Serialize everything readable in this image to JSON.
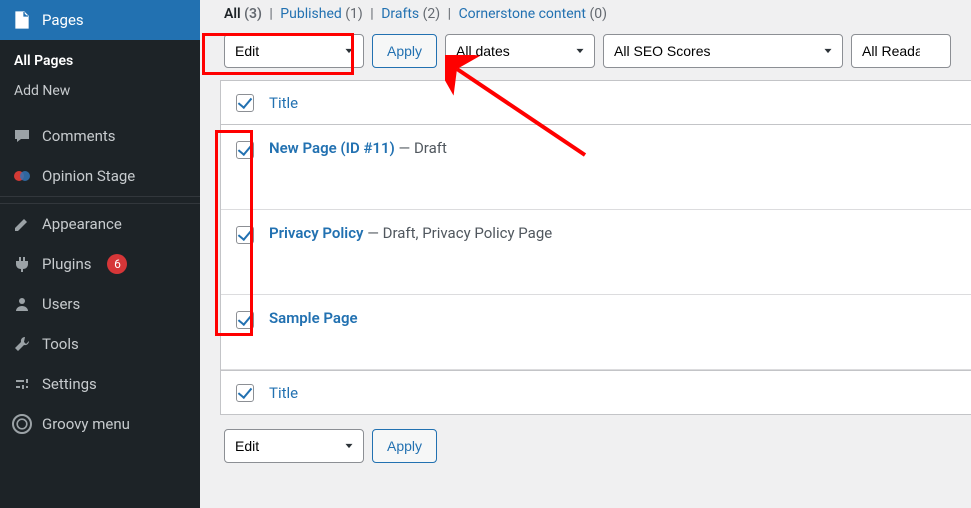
{
  "sidebar": {
    "items": [
      {
        "label": "Pages"
      },
      {
        "label": "Comments"
      },
      {
        "label": "Opinion Stage"
      },
      {
        "label": "Appearance"
      },
      {
        "label": "Plugins",
        "badge": "6"
      },
      {
        "label": "Users"
      },
      {
        "label": "Tools"
      },
      {
        "label": "Settings"
      },
      {
        "label": "Groovy menu"
      }
    ],
    "submenu": [
      {
        "label": "All Pages"
      },
      {
        "label": "Add New"
      }
    ]
  },
  "filters": {
    "all": {
      "label": "All",
      "count": "(3)"
    },
    "published": {
      "label": "Published",
      "count": "(1)"
    },
    "drafts": {
      "label": "Drafts",
      "count": "(2)"
    },
    "cornerstone": {
      "label": "Cornerstone content",
      "count": "(0)"
    }
  },
  "bulk": {
    "action_value": "Edit",
    "apply_label": "Apply",
    "dates_value": "All dates",
    "seo_value": "All SEO Scores",
    "readability_value": "All Readal"
  },
  "table": {
    "title_col": "Title",
    "rows": [
      {
        "title": "New Page (ID #11)",
        "status": " — Draft"
      },
      {
        "title": "Privacy Policy",
        "status": " — Draft, Privacy Policy Page"
      },
      {
        "title": "Sample Page",
        "status": ""
      }
    ]
  }
}
